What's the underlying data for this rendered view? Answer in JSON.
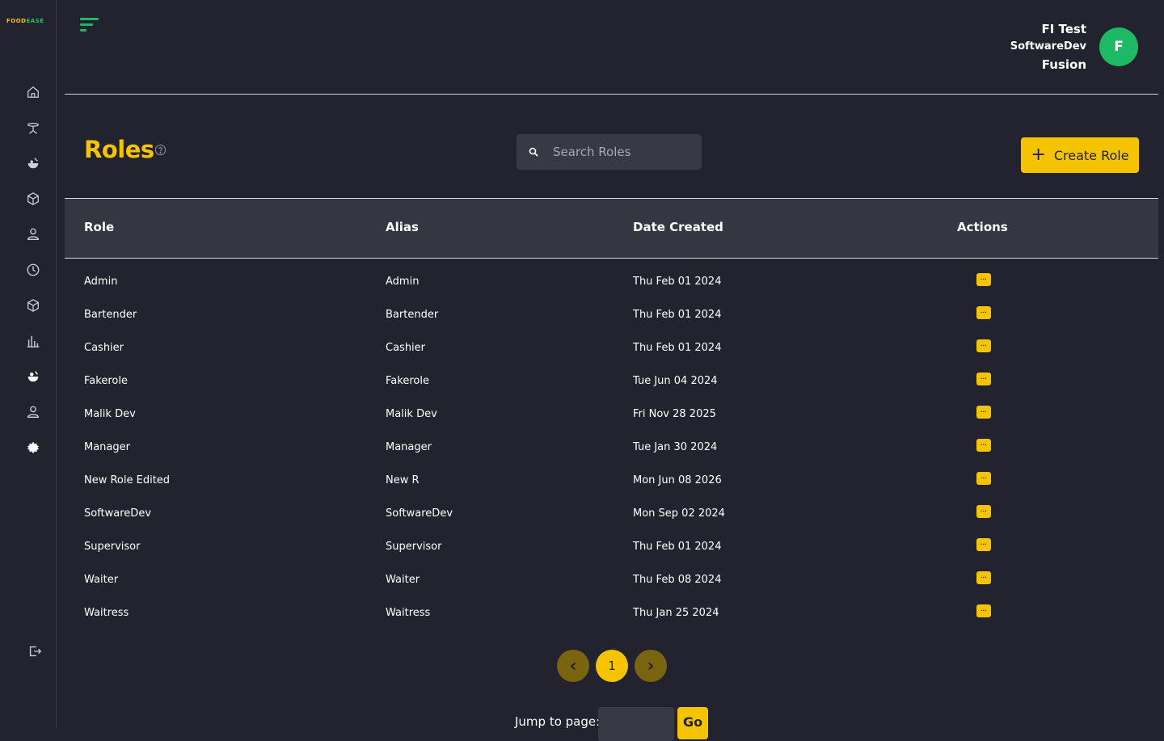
{
  "logo": {
    "part1": "FOOD",
    "part2": "EASE"
  },
  "sidebar": {
    "items": [
      {
        "name": "home-icon"
      },
      {
        "name": "table-icon"
      },
      {
        "name": "food-icon"
      },
      {
        "name": "package-icon"
      },
      {
        "name": "user-icon"
      },
      {
        "name": "clock-icon"
      },
      {
        "name": "inventory-icon"
      },
      {
        "name": "chart-icon"
      },
      {
        "name": "menu-food-icon"
      },
      {
        "name": "staff-icon"
      },
      {
        "name": "settings-icon"
      }
    ],
    "logout": "logout-icon"
  },
  "user": {
    "name": "FI Test",
    "role": "SoftwareDev",
    "org": "Fusion",
    "initial": "F"
  },
  "page": {
    "title": "Roles"
  },
  "search": {
    "placeholder": "Search Roles"
  },
  "create_button": {
    "label": "Create Role"
  },
  "table": {
    "headers": {
      "role": "Role",
      "alias": "Alias",
      "date": "Date Created",
      "actions": "Actions"
    },
    "rows": [
      {
        "role": "Admin",
        "alias": "Admin",
        "date": "Thu Feb 01 2024"
      },
      {
        "role": "Bartender",
        "alias": "Bartender",
        "date": "Thu Feb 01 2024"
      },
      {
        "role": "Cashier",
        "alias": "Cashier",
        "date": "Thu Feb 01 2024"
      },
      {
        "role": "Fakerole",
        "alias": "Fakerole",
        "date": "Tue Jun 04 2024"
      },
      {
        "role": "Malik Dev",
        "alias": "Malik Dev",
        "date": "Fri Nov 28 2025"
      },
      {
        "role": "Manager",
        "alias": "Manager",
        "date": "Tue Jan 30 2024"
      },
      {
        "role": "New Role Edited",
        "alias": "New R",
        "date": "Mon Jun 08 2026"
      },
      {
        "role": "SoftwareDev",
        "alias": "SoftwareDev",
        "date": "Mon Sep 02 2024"
      },
      {
        "role": "Supervisor",
        "alias": "Supervisor",
        "date": "Thu Feb 01 2024"
      },
      {
        "role": "Waiter",
        "alias": "Waiter",
        "date": "Thu Feb 08 2024"
      },
      {
        "role": "Waitress",
        "alias": "Waitress",
        "date": "Thu Jan 25 2024"
      }
    ],
    "action_label": "···"
  },
  "pagination": {
    "current": "1",
    "prev_label": "‹",
    "next_label": "›"
  },
  "jump": {
    "label": "Jump to page:",
    "go_label": "Go"
  },
  "colors": {
    "accent": "#f5c400",
    "background": "#23232f",
    "avatar": "#1db964"
  }
}
